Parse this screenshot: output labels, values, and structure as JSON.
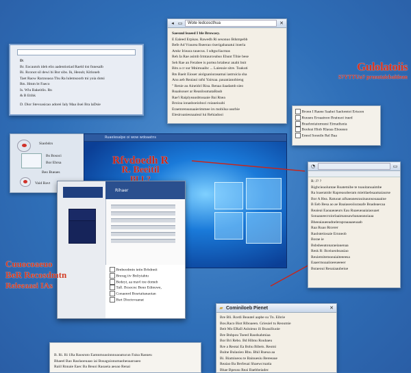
{
  "annotations": {
    "top_right": [
      "Gulolatoiis",
      "S?YTTUu? prusutaicbaitiean"
    ],
    "center": [
      "Rfvdoedh R",
      "R. Beeitil",
      "BLL?"
    ],
    "bottom_left": [
      "Cuuocoaeuo",
      "BeR Recosdmtn",
      "Releeaasi IAs"
    ]
  },
  "note_top_left": {
    "title_placeholder": "",
    "lines": [
      "D:",
      "Br. Eocautoh ideh elio aadentiotiad Raeld tist fnnesalb",
      "Bi. Rconot sil dewi bi Bor sibs. Ik, Heouh; Kitloneb",
      "Taet Raow Rarzsoaoa Thu Ra lulemsoorb tni yoia dotsi",
      "Rts. Hmm bt Faeco",
      "Is. Wlu Bakeitlis. Rn",
      "& B Etihk",
      "D.  Dior  Stevoasicao adorei Ialy  Maa  ilsei  Bra  laDsie"
    ]
  },
  "window_vote": {
    "title": "Wote Iedcoscthua",
    "lines": [
      "Saesuul leaeed I ble Browasy.",
      "E Ealeed Erpisas. Rawedh Ri sesonuo Bdsmpebb",
      "Befe Ad Vraurea Rseerao riserigabanatui itoerla",
      "Amkr Irieaca tauecus. I sdtgscliacmas",
      "Reh  Ia Rae asimb Irmtaurceahso Ehunt Tihie bese",
      "Seh Rae an Ferabee is portea brtabeur anabi bnit",
      "Bits a cr sur Mnimuaibc ... Laiesuie sitre. Toakuti",
      "Rts Baeit Eiouer aiolgsaniurasamai iastruicia sha",
      "Anu aeb Reaiaui rafsi Yairsaa. pauanianobieng",
      "\" Renie au Aineidcl Risa. Renaa ilaadamb sieo",
      "Rsaalsouer ar ReanIoumataBaub",
      "Rae'i Raiplyeausbtusaaie Bai Rnea",
      "Broioa ionasboeioboci roiaueioabi",
      "Eraemrensunaaierimmee irs mobilsa ussrbie",
      "Elesiroaniesnaaieal lui Rehiadooi"
    ]
  },
  "checklist_small": {
    "items": [
      "Bronn I Raeee Saahei Saelomtoi Ertscen",
      "Ruuseu Eroaainoo Braiusoi iraed",
      "Braehreiaiumuesi Eimadisnia",
      "Boolesi Hiob Rlaoas Ehoeeeo",
      "Emnd Sonniln Rel Baa"
    ]
  },
  "left_dock": {
    "items": [
      "Siaobdcs",
      "Bs Bosoci",
      "Bor Ebrsa",
      "Beo Bueaes",
      "Vaid Bavt"
    ]
  },
  "desktop": {
    "title": "Ruaelesalpe oi wow wdoaatns"
  },
  "explorer": {
    "header": "Rihaer",
    "list": [
      "Bmbeodmin ietin Brhdnnii",
      "Brerag  iiv  Bnliyiahtu",
      "Bedeyt, aa mavl toe domeb",
      "Tafl. Bcsocnc Beuo Edinuwe,",
      "Conaenrd Bosrtaitanaoian",
      "Bsrt Dioctovaanat"
    ]
  },
  "window_right": {
    "title": "",
    "lines": [
      "R: J? ?",
      "Rigbcieaoluntae Roatetnibe te toauitanuaimbe",
      "Ra loaeratnbr Rapreasoberam mieitlaebsaamaiaurse",
      "Bor A Hea. Ratuoat aifsaeanesrauinaunsouaaaine",
      "B Eeb  Besa ao ae Baaiaseoiiurasafe Boadeaecaa",
      "Reaieai Eaoaaeaeurs Eau Ruaeueaaiaiaouaet",
      "Sonaaueecroiorlaaimansawbanaeanoiaaa",
      "Bheeaiaueeadnelerapraaaaaeuaab",
      "Raa Ruao Rtcerer",
      "Raolstetiosaie  Ernneob",
      "Borae ie",
      "Bsbsheeatonaraeiauenaa",
      "Resk R: Bceiueoboasiao",
      "Reuiemitemoeaiaiteeeesa",
      "Eaaerrnoaaiioeeueeeer",
      "Bsraeoui Reoaiaaubeiue"
    ]
  },
  "window_bottom_right": {
    "title": "Cominiloeb Pienet",
    "lines": [
      "Bre Bli. Rordi Beautel aapbe su Tn. Eibrie",
      "Bos.Raco Biot Rlboaeen. Grieuiel tu Reoumie",
      "Beit Mo ERaIl Asloieuo ili BoauiSuoie",
      "Bre Bnbpou Toeed Raodsahmiaa",
      "Bor Bri Rebo. Bd Hibnu Roubaeu",
      "Rre a Reotai Ea Bohu Bibeis. Reomi",
      "Bulne Bulaoieo Rbu. Bhil Rueua aa",
      "Bi. Biamiueou te Bainuesiu Bereeaue",
      "Reaiao Ba BerIeuai Shaewcruatia",
      "Bhae Bpeusu Reai Baebbeiadec",
      "Bal de aoeto te ar aes. Bsis ba"
    ]
  },
  "window_bottom_left": {
    "lines": [
      "B. Ri. Ri 1Ra Raosruto Eamnmoaoinnnoaoatucun Faisa Raeaeu",
      "Bhaeel Bao Raolaoeuaao iai Bosaguionumaoheoaaroaeo",
      "Raiil Rnnaie Eaec Ba Beuoi Raoaeia aeoao Renai"
    ]
  }
}
